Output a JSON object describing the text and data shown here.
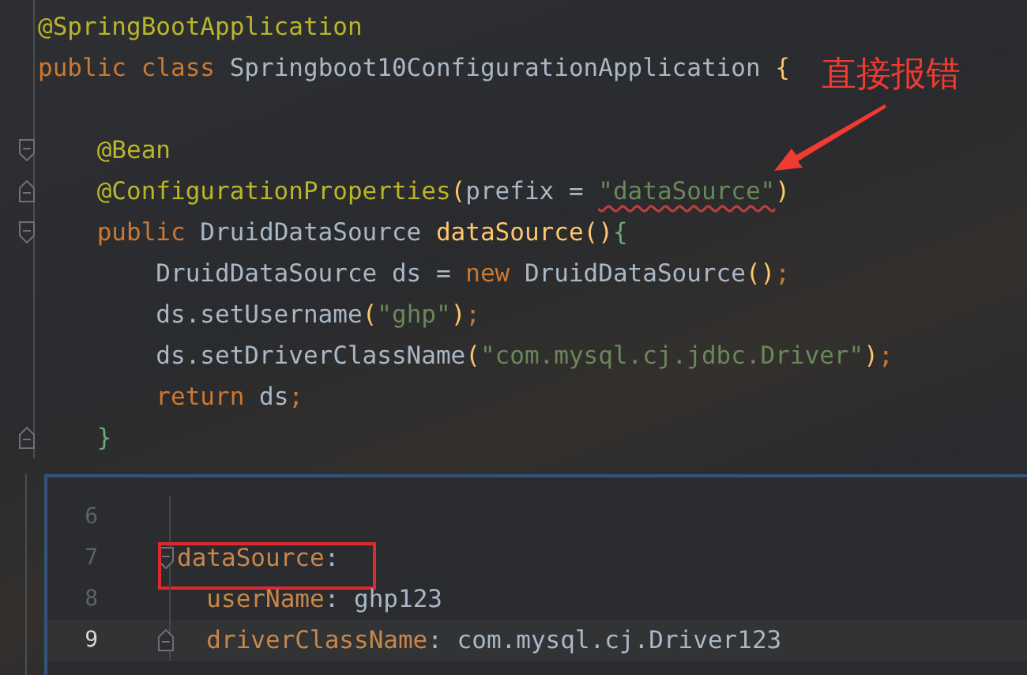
{
  "java_lines": [
    {
      "tokens": [
        {
          "text": "@SpringBootApplication",
          "kind": "annotation"
        }
      ]
    },
    {
      "tokens": [
        {
          "text": "public class ",
          "kind": "keyword"
        },
        {
          "text": "Springboot10ConfigurationApplication ",
          "kind": "plain"
        },
        {
          "text": "{",
          "kind": "bracket",
          "color": "#ffc66d"
        }
      ]
    },
    {
      "gap_before": true,
      "fold": {
        "kind": "start"
      },
      "tokens": [
        {
          "text": "    @Bean",
          "kind": "annotation"
        }
      ]
    },
    {
      "fold": {
        "kind": "end"
      },
      "tokens": [
        {
          "text": "    @ConfigurationProperties",
          "kind": "annotation"
        },
        {
          "text": "(",
          "kind": "bracket",
          "color": "#ffc66d"
        },
        {
          "text": "prefix = ",
          "kind": "plain"
        },
        {
          "text": "\"dataSource\"",
          "kind": "string",
          "error": true
        },
        {
          "text": ")",
          "kind": "bracket",
          "color": "#ffc66d"
        }
      ]
    },
    {
      "fold": {
        "kind": "start"
      },
      "tokens": [
        {
          "text": "    public ",
          "kind": "keyword"
        },
        {
          "text": "DruidDataSource ",
          "kind": "plain"
        },
        {
          "text": "dataSource",
          "kind": "method"
        },
        {
          "text": "()",
          "kind": "bracket",
          "color": "#ffc66d"
        },
        {
          "text": "{",
          "kind": "bracket",
          "color": "#6aab73"
        }
      ]
    },
    {
      "tokens": [
        {
          "text": "        DruidDataSource ds = ",
          "kind": "plain"
        },
        {
          "text": "new ",
          "kind": "keyword"
        },
        {
          "text": "DruidDataSource",
          "kind": "plain"
        },
        {
          "text": "()",
          "kind": "bracket",
          "color": "#ffc66d"
        },
        {
          "text": ";",
          "kind": "punct"
        }
      ]
    },
    {
      "tokens": [
        {
          "text": "        ds.setUsername",
          "kind": "plain"
        },
        {
          "text": "(",
          "kind": "bracket",
          "color": "#ffc66d"
        },
        {
          "text": "\"ghp\"",
          "kind": "string",
          "error": false
        },
        {
          "text": ")",
          "kind": "bracket",
          "color": "#ffc66d"
        },
        {
          "text": ";",
          "kind": "punct"
        }
      ]
    },
    {
      "tokens": [
        {
          "text": "        ds.setDriverClassName",
          "kind": "plain"
        },
        {
          "text": "(",
          "kind": "bracket",
          "color": "#ffc66d"
        },
        {
          "text": "\"com.mysql.cj.jdbc.Driver\"",
          "kind": "string",
          "error": false
        },
        {
          "text": ")",
          "kind": "bracket",
          "color": "#ffc66d"
        },
        {
          "text": ";",
          "kind": "punct"
        }
      ]
    },
    {
      "tokens": [
        {
          "text": "        return ",
          "kind": "keyword"
        },
        {
          "text": "ds",
          "kind": "plain"
        },
        {
          "text": ";",
          "kind": "punct"
        }
      ]
    },
    {
      "fold": {
        "kind": "end"
      },
      "tokens": [
        {
          "text": "    }",
          "kind": "bracket",
          "color": "#6aab73"
        }
      ]
    }
  ],
  "yaml_lines": [
    {
      "number": "6",
      "current": false
    },
    {
      "number": "7",
      "current": false,
      "boxed": true,
      "fold": {
        "kind": "start"
      },
      "tokens": [
        {
          "text": "dataSource",
          "kind": "key"
        },
        {
          "text": ":",
          "kind": "plain"
        }
      ]
    },
    {
      "number": "8",
      "current": false,
      "tokens": [
        {
          "text": "  userName",
          "kind": "key"
        },
        {
          "text": ": ghp123",
          "kind": "plain"
        }
      ]
    },
    {
      "number": "9",
      "current": true,
      "fold": {
        "kind": "end"
      },
      "tokens": [
        {
          "text": "  driverClassName",
          "kind": "key"
        },
        {
          "text": ": com.mysql.cj.Driver123",
          "kind": "plain"
        }
      ]
    }
  ],
  "annotation": {
    "text": "直接报错"
  }
}
